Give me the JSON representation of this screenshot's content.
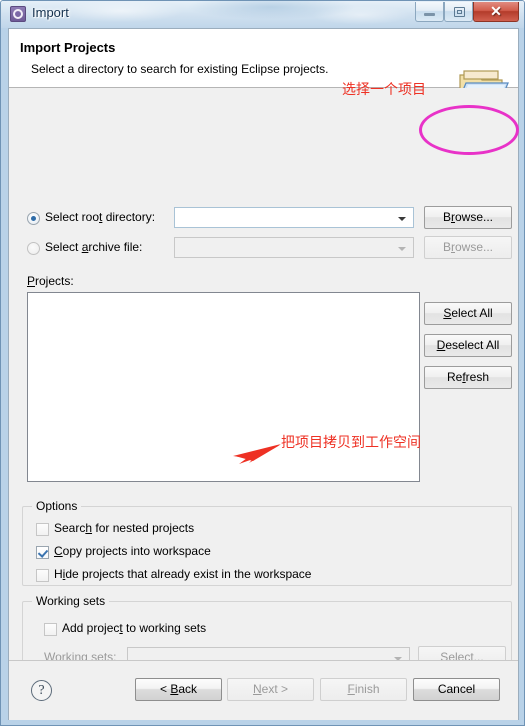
{
  "window": {
    "title": "Import",
    "app_icon": "eclipse-gear-icon",
    "controls": {
      "minimize": "minimize-button",
      "maximize": "maximize-button",
      "close_label": "✕"
    }
  },
  "header": {
    "title": "Import Projects",
    "description": "Select a directory to search for existing Eclipse projects.",
    "icon": "import-folder-icon"
  },
  "source": {
    "root_directory": {
      "label_before": "Select roo",
      "label_mnemonic": "t",
      "label_after": " directory:",
      "selected": true,
      "value": "",
      "browse_label_before": "B",
      "browse_label_mnemonic": "r",
      "browse_label_after": "owse..."
    },
    "archive_file": {
      "label_before": "Select ",
      "label_mnemonic": "a",
      "label_after": "rchive file:",
      "selected": false,
      "value": "",
      "browse_label_before": "B",
      "browse_label_mnemonic": "r",
      "browse_label_after": "owse..."
    }
  },
  "projects": {
    "label_mnemonic": "P",
    "label_after": "rojects:",
    "items": [],
    "buttons": [
      {
        "name": "select-all-button",
        "before": "",
        "mnemonic": "S",
        "after": "elect All",
        "disabled": false
      },
      {
        "name": "deselect-all-button",
        "before": "",
        "mnemonic": "D",
        "after": "eselect All",
        "disabled": false
      },
      {
        "name": "refresh-button",
        "before": "Re",
        "mnemonic": "f",
        "after": "resh",
        "disabled": false
      }
    ]
  },
  "options": {
    "title": "Options",
    "items": [
      {
        "before": "Searc",
        "mnemonic": "h",
        "after": " for nested projects",
        "checked": false
      },
      {
        "before": "",
        "mnemonic": "C",
        "after": "opy projects into workspace",
        "checked": true
      },
      {
        "before": "H",
        "mnemonic": "i",
        "after": "de projects that already exist in the workspace",
        "checked": false
      }
    ]
  },
  "working_sets": {
    "title": "Working sets",
    "checkbox": {
      "before": "Add projec",
      "mnemonic": "t",
      "after": " to working sets",
      "checked": false
    },
    "combo_label_before": "W",
    "combo_label_mnemonic": "o",
    "combo_label_after": "rking sets:",
    "combo_value": "",
    "select_button_before": "S",
    "select_button_mnemonic": "e",
    "select_button_after": "lect...",
    "disabled": true
  },
  "footer": {
    "help_label": "?",
    "buttons": [
      {
        "name": "back-button",
        "before": "< ",
        "mnemonic": "B",
        "after": "ack",
        "disabled": false,
        "default": true
      },
      {
        "name": "next-button",
        "before": "",
        "mnemonic": "N",
        "after": "ext >",
        "disabled": true,
        "default": false
      },
      {
        "name": "finish-button",
        "before": "",
        "mnemonic": "F",
        "after": "inish",
        "disabled": true,
        "default": false
      },
      {
        "name": "cancel-button",
        "before": "Cancel",
        "mnemonic": "",
        "after": "",
        "disabled": false,
        "default": true
      }
    ]
  },
  "annotations": {
    "select_project": "选择一个项目",
    "copy_to_workspace": "把项目拷贝到工作空间",
    "ellipse_color": "#e832c8",
    "text_color": "#ee3124",
    "arrow_color": "#ee3124"
  }
}
